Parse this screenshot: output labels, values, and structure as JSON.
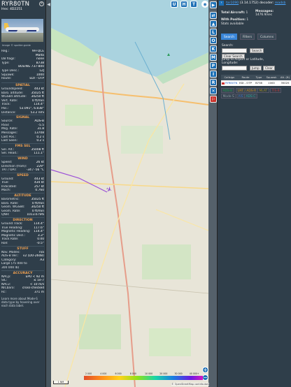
{
  "info": {
    "callsign": "RYR80TN",
    "hex_label": "Hex:",
    "hex": "4D2251",
    "photo_credit": "Image © spotter.guide",
    "close_icon": "×",
    "details": [
      {
        "k": "Reg.:",
        "v": "9H-QCE"
      },
      {
        "k": "",
        "v": "Malta"
      },
      {
        "k": "DB flags:",
        "v": "none"
      },
      {
        "k": "Type:",
        "v": "B738"
      },
      {
        "k": "",
        "v": "BOEING 737-800"
      },
      {
        "k": "Type Desc.:",
        "v": "L2J"
      },
      {
        "k": "Squawk:",
        "v": "1000"
      },
      {
        "k": "Route:",
        "v": "EDI - OTP"
      }
    ],
    "sections": [
      {
        "title": "SPATIAL",
        "rows": [
          {
            "k": "Groundspeed:",
            "v": "443 kt"
          },
          {
            "k": "Baro. altitude:",
            "v": "35025 ft"
          },
          {
            "k": "WGS84 altitude:",
            "v": "34250 ft"
          },
          {
            "k": "Vert. Rate:",
            "v": "0 ft/min"
          },
          {
            "k": "Track:",
            "v": "114.4°"
          },
          {
            "k": "Pos.:",
            "v": "53.091°, 6.838°"
          },
          {
            "k": "Distance:",
            "v": "53.2 nmi"
          }
        ]
      },
      {
        "title": "SIGNAL",
        "rows": [
          {
            "k": "Source:",
            "v": "ADS-B"
          },
          {
            "k": "RSSI:",
            "v": "-5.5"
          },
          {
            "k": "Msg. Rate:",
            "v": "31.8"
          },
          {
            "k": "Messages:",
            "v": "13708"
          },
          {
            "k": "Last Pos.:",
            "v": "0.2 s"
          },
          {
            "k": "Last Seen:",
            "v": "0.2 s"
          }
        ]
      },
      {
        "title": "FMS SEL",
        "rows": [
          {
            "k": "Sel. Alt.:",
            "v": "35008 ft"
          },
          {
            "k": "Sel. Head.:",
            "v": "111.1°"
          }
        ]
      },
      {
        "title": "WIND",
        "rows": [
          {
            "k": "Speed:",
            "v": "26 kt"
          },
          {
            "k": "Direction (from):",
            "v": "229°"
          },
          {
            "k": "TAT / OAT:",
            "v": "-34 / -56 °C"
          }
        ]
      },
      {
        "title": "SPEED",
        "rows": [
          {
            "k": "Ground:",
            "v": "443 kt"
          },
          {
            "k": "True:",
            "v": "434 kt"
          },
          {
            "k": "Indicated:",
            "v": "257 kt"
          },
          {
            "k": "Mach:",
            "v": "0.760"
          }
        ]
      },
      {
        "title": "ALTITUDE",
        "rows": [
          {
            "k": "Barometric:",
            "v": "35025 ft"
          },
          {
            "k": "Baro. Rate:",
            "v": "0 ft/min"
          },
          {
            "k": "Geom. WGS84:",
            "v": "34250 ft"
          },
          {
            "k": "Geom. Rate:",
            "v": "0 ft/min"
          },
          {
            "k": "QNH:",
            "v": "1013.6 hPa"
          }
        ]
      },
      {
        "title": "DIRECTION",
        "rows": [
          {
            "k": "Ground Track:",
            "v": "114.4°"
          },
          {
            "k": "True Heading:",
            "v": "117.6°"
          },
          {
            "k": "Magnetic Heading:",
            "v": "114.4°"
          },
          {
            "k": "Magnetic Decl.:",
            "v": "3.3°"
          },
          {
            "k": "Track Rate:",
            "v": "0.00"
          },
          {
            "k": "Roll:",
            "v": "-0.5°"
          }
        ]
      },
      {
        "title": "STUFF",
        "rows": [
          {
            "k": "Nav. Modes:",
            "v": "n/a"
          },
          {
            "k": "ADS-B Ver.:",
            "v": "v2 (DO-260B)"
          },
          {
            "k": "Category:",
            "v": "A3"
          },
          {
            "k": "Large (75 000 to",
            "v": ""
          },
          {
            "k": "300 000 lb)",
            "v": ""
          }
        ]
      },
      {
        "title": "ACCURACY",
        "rows": [
          {
            "k": "NACp:",
            "v": "EPU < 92 m"
          },
          {
            "k": "SIL:",
            "v": "≤ 1e-7"
          },
          {
            "k": "NACv:",
            "v": "< 10 m/s"
          },
          {
            "k": "NICbaro:",
            "v": "cross-checked"
          },
          {
            "k": "Rc:",
            "v": "371 m"
          }
        ]
      }
    ],
    "footer": "Learn more about Mode-S data type by hovering over each data label."
  },
  "left_icons": [
    "◀",
    "▶"
  ],
  "map_buttons": [
    "U",
    "H",
    "T"
  ],
  "map_round": "◉",
  "vert_buttons": [
    "L",
    "O",
    "K",
    "M",
    "P",
    "I",
    "R"
  ],
  "vert_icons": [
    "⇄",
    "▲",
    "✕",
    "⚐"
  ],
  "zoom": {
    "in": "+",
    "out": "−"
  },
  "scale": "1 NM",
  "colorbar_ticks": [
    "2 000",
    "4 000",
    "6 000",
    "8 000",
    "10 000",
    "20 000",
    "30 000",
    "40 000+"
  ],
  "attribution": "© OpenStreetMap contributors",
  "side": {
    "version_link": "tar1090",
    "version": "(3.14.1752)",
    "decoder_label": "decoder:",
    "decoder": "readsb",
    "total_label": "Total Aircraft:",
    "total": "1",
    "messages_label": "Messages:",
    "messages": "1476.9/sec",
    "withpos_label": "With Position:",
    "withpos": "1",
    "history": "Stats available",
    "tabs": [
      "Search",
      "Filters",
      "Columns"
    ],
    "search_label": "Search:",
    "search_btn": "Search",
    "clear_search": "Clear Search",
    "jump_label": "Jump to Airport or Latitude, Longitude:",
    "jump_btn": "Jump",
    "clear_btn": "Clear",
    "table_headers": [
      "Callsign",
      "Route",
      "Type",
      "Squawk",
      "Alt. (ft)"
    ],
    "table_rows": [
      {
        "callsign": "RYR80TN",
        "route": "EDI - OTP",
        "type": "B738",
        "squawk": "1000",
        "alt": "35025"
      }
    ],
    "legend": [
      {
        "label": "ADS-B",
        "color": "#1c9a4a"
      },
      {
        "label": "UAT / ADS-R",
        "color": "#cf8c16"
      },
      {
        "label": "MLAT",
        "color": "#a08a22"
      },
      {
        "label": "TIS-B",
        "color": "#c23b3b"
      },
      {
        "label": "Mode-S",
        "color": "#9aa5ad"
      },
      {
        "label": "AIS",
        "color": "#3b6ec2"
      },
      {
        "label": "ADS-C",
        "color": "#2aa39a"
      }
    ]
  }
}
